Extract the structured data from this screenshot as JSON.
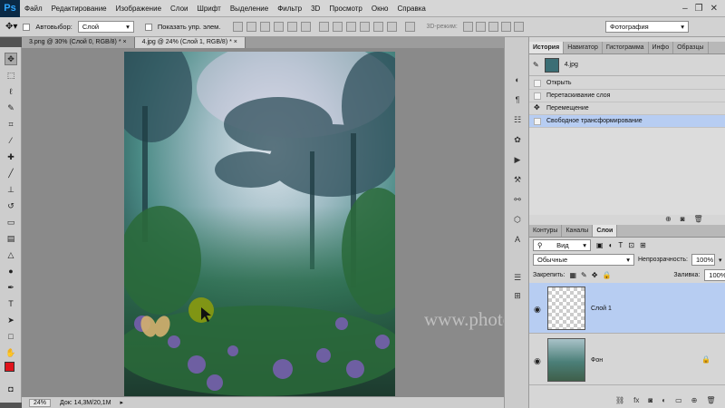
{
  "menubar": {
    "logo": "Ps",
    "items": [
      "Файл",
      "Редактирование",
      "Изображение",
      "Слои",
      "Шрифт",
      "Выделение",
      "Фильтр",
      "3D",
      "Просмотр",
      "Окно",
      "Справка"
    ]
  },
  "options_bar": {
    "autoselect_label": "Автовыбор:",
    "autoselect_value": "Слой",
    "show_controls_label": "Показать упр. элем.",
    "mode_3d_label": "3D-режим:",
    "workspace_value": "Фотография"
  },
  "document_tabs": [
    {
      "label": "3.png @ 30% (Слой 0, RGB/8) *",
      "active": false
    },
    {
      "label": "4.jpg @ 24% (Слой 1, RGB/8) *",
      "active": true
    }
  ],
  "statusbar": {
    "zoom": "24%",
    "doc_info": "Док: 14,3M/20,1M"
  },
  "watermark": "www.photoshopsunduchok.ru",
  "history_panel": {
    "tabs": [
      "История",
      "Навигатор",
      "Гистограмма",
      "Инфо",
      "Образцы"
    ],
    "snapshot_name": "4.jpg",
    "steps": [
      "Открыть",
      "Перетаскивание слоя",
      "Перемещение",
      "Свободное трансформирование"
    ],
    "selected_index": 3
  },
  "layers_panel": {
    "tabs": [
      "Контуры",
      "Каналы",
      "Слои"
    ],
    "filter_kind": "Вид",
    "blend_mode": "Обычные",
    "opacity_label": "Непрозрачность:",
    "opacity_value": "100%",
    "lock_label": "Закрепить:",
    "fill_label": "Заливка:",
    "fill_value": "100%",
    "layers": [
      {
        "name": "Слой 1",
        "selected": true
      },
      {
        "name": "Фон",
        "selected": false
      }
    ]
  },
  "colors": {
    "foreground": "#e0141c",
    "background": "#ffffff",
    "selection": "#b7cdf2"
  }
}
